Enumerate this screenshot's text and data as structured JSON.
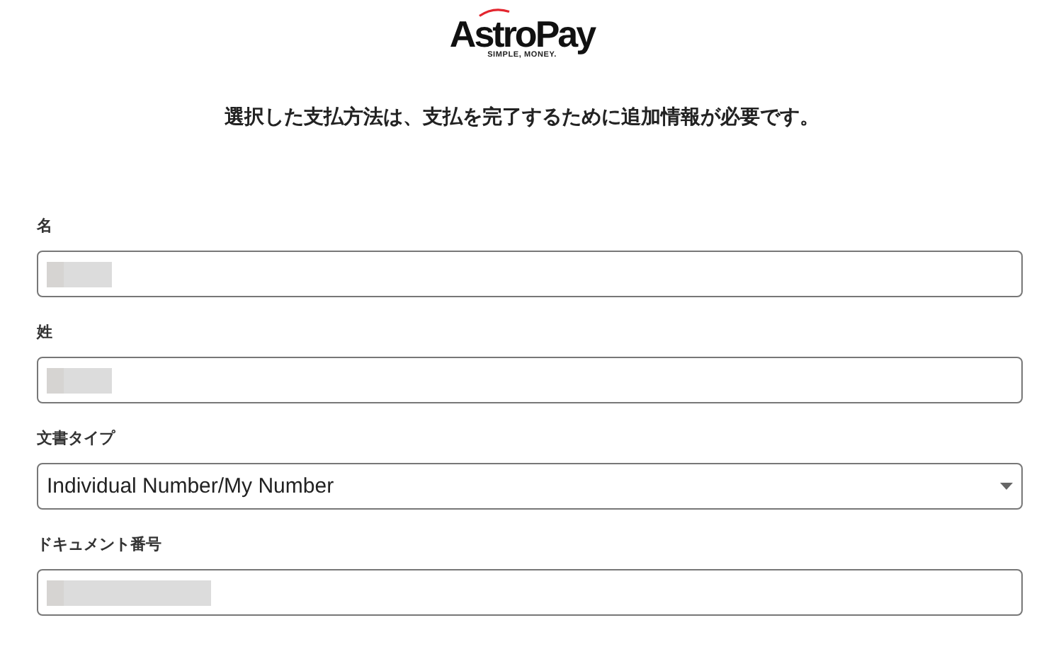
{
  "logo": {
    "name": "AstroPay",
    "tagline": "SIMPLE, MONEY."
  },
  "heading": "選択した支払方法は、支払を完了するために追加情報が必要です。",
  "fields": [
    {
      "kind": "text",
      "label": "名",
      "redacted": true
    },
    {
      "kind": "text",
      "label": "姓",
      "redacted": true
    },
    {
      "kind": "select",
      "label": "文書タイプ",
      "value": "Individual Number/My Number"
    },
    {
      "kind": "text",
      "label": "ドキュメント番号",
      "redacted": true
    }
  ]
}
